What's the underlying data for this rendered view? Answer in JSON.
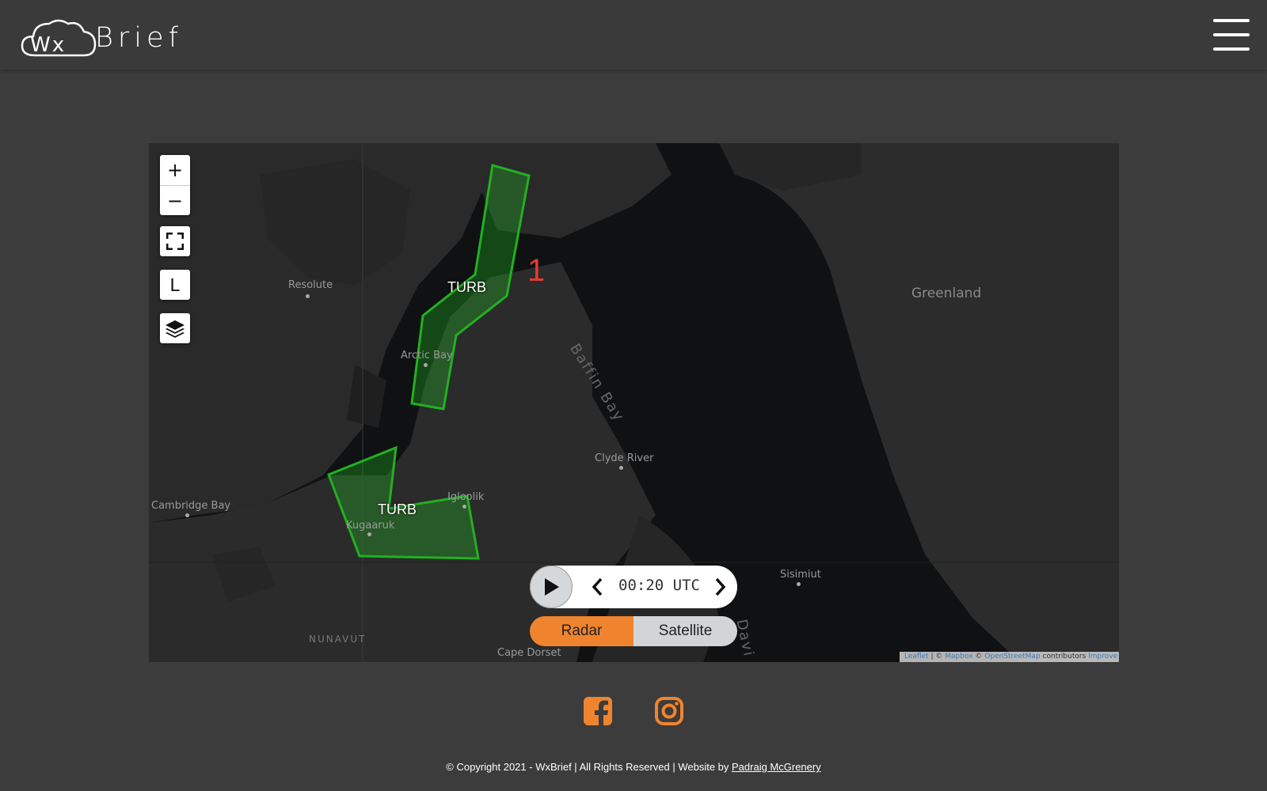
{
  "header": {
    "logo_text": "WxBrief"
  },
  "map": {
    "controls": {
      "zoom_in": "+",
      "zoom_out": "−",
      "legend_label": "L"
    },
    "places": {
      "resolute": "Resolute",
      "arctic_bay": "Arctic Bay",
      "clyde_river": "Clyde River",
      "cambridge_bay": "Cambridge Bay",
      "igloolik": "Igloolik",
      "kugaaruk": "Kugaaruk",
      "sisimiut": "Sisimiut",
      "cape_dorset": "Cape Dorset",
      "greenland": "Greenland",
      "baffin_bay": "Baffin Bay",
      "nunavut": "NUNAVUT",
      "davis": "Davi"
    },
    "sigmets": [
      {
        "label": "TURB",
        "number": "1"
      },
      {
        "label": "TURB"
      }
    ],
    "sigmet_color": "#22b022",
    "player": {
      "time": "00:20 UTC"
    },
    "layer_toggle": {
      "radar": "Radar",
      "satellite": "Satellite",
      "active": "Radar",
      "active_color": "#f0842e"
    },
    "attribution": {
      "leaflet": "Leaflet",
      "sep1": " | © ",
      "mapbox": "Mapbox",
      "sep2": " © ",
      "osm": "OpenStreetMap",
      "contributors": " contributors ",
      "improve": "Improve this map"
    }
  },
  "footer": {
    "social": [
      "facebook-icon",
      "instagram-icon"
    ],
    "social_color": "#f0842e",
    "copyright_text": "Copyright 2021 - WxBrief | All Rights Reserved | Website by ",
    "author_link": "Padraig McGrenery"
  }
}
